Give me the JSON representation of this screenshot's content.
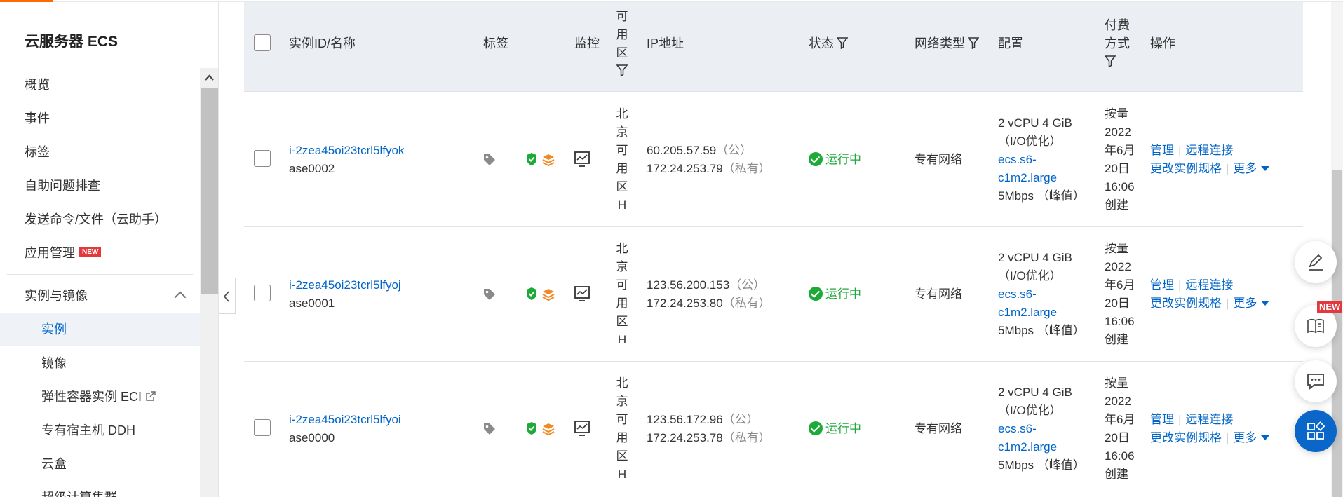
{
  "sidebar": {
    "title": "云服务器 ECS",
    "items": [
      {
        "label": "概览"
      },
      {
        "label": "事件"
      },
      {
        "label": "标签"
      },
      {
        "label": "自助问题排查"
      },
      {
        "label": "发送命令/文件（云助手）"
      },
      {
        "label": "应用管理",
        "badge": "NEW"
      }
    ],
    "group": {
      "label": "实例与镜像"
    },
    "subitems": [
      {
        "label": "实例",
        "active": true
      },
      {
        "label": "镜像"
      },
      {
        "label": "弹性容器实例 ECI",
        "external": true
      },
      {
        "label": "专有宿主机 DDH"
      },
      {
        "label": "云盒"
      },
      {
        "label": "超级计算集群"
      }
    ]
  },
  "table": {
    "headers": {
      "instance": "实例ID/名称",
      "tags": "标签",
      "monitor": "监控",
      "zone_chars": [
        "可",
        "用",
        "区"
      ],
      "ip": "IP地址",
      "status": "状态",
      "network": "网络类型",
      "config": "配置",
      "billing_line1": "付费",
      "billing_line2": "方式",
      "actions": "操作"
    },
    "rows": [
      {
        "id": "i-2zea45oi23tcrl5lfyok",
        "name": "ase0002",
        "zone_chars": [
          "北",
          "京",
          "可",
          "用",
          "区",
          "H"
        ],
        "public_ip": "60.205.57.59",
        "public_tag": "（公）",
        "private_ip": "172.24.253.79",
        "private_tag": "（私有）",
        "status": "运行中",
        "network": "专有网络",
        "config_line1": "2 vCPU 4 GiB",
        "config_line2": "（I/O优化）",
        "config_spec1": "ecs.s6-",
        "config_spec2": "c1m2.large",
        "config_bw": "5Mbps （峰值）",
        "billing": [
          "按量",
          "2022",
          "年6月",
          "20日",
          "16:06",
          "创建"
        ],
        "action_manage": "管理",
        "action_remote": "远程连接",
        "action_resize": "更改实例规格",
        "action_more": "更多"
      },
      {
        "id": "i-2zea45oi23tcrl5lfyoj",
        "name": "ase0001",
        "zone_chars": [
          "北",
          "京",
          "可",
          "用",
          "区",
          "H"
        ],
        "public_ip": "123.56.200.153",
        "public_tag": "（公）",
        "private_ip": "172.24.253.80",
        "private_tag": "（私有）",
        "status": "运行中",
        "network": "专有网络",
        "config_line1": "2 vCPU 4 GiB",
        "config_line2": "（I/O优化）",
        "config_spec1": "ecs.s6-",
        "config_spec2": "c1m2.large",
        "config_bw": "5Mbps （峰值）",
        "billing": [
          "按量",
          "2022",
          "年6月",
          "20日",
          "16:06",
          "创建"
        ],
        "action_manage": "管理",
        "action_remote": "远程连接",
        "action_resize": "更改实例规格",
        "action_more": "更多"
      },
      {
        "id": "i-2zea45oi23tcrl5lfyoi",
        "name": "ase0000",
        "zone_chars": [
          "北",
          "京",
          "可",
          "用",
          "区",
          "H"
        ],
        "public_ip": "123.56.172.96",
        "public_tag": "（公）",
        "private_ip": "172.24.253.78",
        "private_tag": "（私有）",
        "status": "运行中",
        "network": "专有网络",
        "config_line1": "2 vCPU 4 GiB",
        "config_line2": "（I/O优化）",
        "config_spec1": "ecs.s6-",
        "config_spec2": "c1m2.large",
        "config_bw": "5Mbps （峰值）",
        "billing": [
          "按量",
          "2022",
          "年6月",
          "20日",
          "16:06",
          "创建"
        ],
        "action_manage": "管理",
        "action_remote": "远程连接",
        "action_resize": "更改实例规格",
        "action_more": "更多"
      }
    ]
  },
  "floating": {
    "new_badge": "NEW"
  },
  "colors": {
    "accent": "#ff6a00",
    "link": "#0064c8",
    "success": "#1eaa39",
    "header_bg": "#ebeff4",
    "fab_blue": "#0a66c8"
  }
}
